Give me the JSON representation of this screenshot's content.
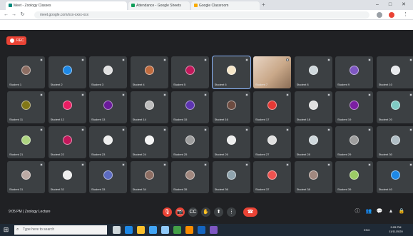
{
  "browser": {
    "tabs": [
      {
        "title": "Meet - Zoology Classes"
      },
      {
        "title": "Attendance - Google Sheets"
      },
      {
        "title": "Google Classroom"
      }
    ],
    "address": "meet.google.com/xxx-xxxx-xxx",
    "new_tab_icon": "plus-icon",
    "window_controls": [
      "minimize-icon",
      "maximize-icon",
      "close-icon"
    ]
  },
  "meet": {
    "recording_label": "REC",
    "meeting_time": "9:05 PM",
    "meeting_title": "Zoology Lecture",
    "controls": [
      {
        "name": "mic-off-button",
        "glyph": "🎙",
        "style": "red"
      },
      {
        "name": "camera-off-button",
        "glyph": "📷",
        "style": "red"
      },
      {
        "name": "captions-button",
        "glyph": "CC",
        "style": "dark"
      },
      {
        "name": "raise-hand-button",
        "glyph": "✋",
        "style": "dark"
      },
      {
        "name": "present-button",
        "glyph": "⬆",
        "style": "dark"
      },
      {
        "name": "more-options-button",
        "glyph": "⋮",
        "style": "dark"
      },
      {
        "name": "leave-call-button",
        "glyph": "☎",
        "style": "leave"
      }
    ],
    "right_controls": [
      {
        "name": "info-button",
        "glyph": "ⓘ"
      },
      {
        "name": "people-button",
        "glyph": "👥"
      },
      {
        "name": "chat-button",
        "glyph": "💬"
      },
      {
        "name": "activities-button",
        "glyph": "▲"
      },
      {
        "name": "lock-button",
        "glyph": "🔒"
      }
    ],
    "participants": [
      {
        "name": "Student 1",
        "color": "#8d6e63"
      },
      {
        "name": "Student 2",
        "color": "#1e88e5"
      },
      {
        "name": "Student 3",
        "color": "#e0e0e0"
      },
      {
        "name": "Student 4",
        "color": "#bf6b3f"
      },
      {
        "name": "Student 5",
        "color": "#c2185b"
      },
      {
        "name": "Student 6",
        "color": "#f5e6c8"
      },
      {
        "name": "Student 7",
        "color": "#d7b89b"
      },
      {
        "name": "Student 8",
        "color": "#cfd8dc"
      },
      {
        "name": "Student 9",
        "color": "#7e57c2"
      },
      {
        "name": "Student 10",
        "color": "#e8eaed"
      },
      {
        "name": "Student 11",
        "color": "#827717"
      },
      {
        "name": "Student 12",
        "color": "#e91e63"
      },
      {
        "name": "Student 13",
        "color": "#6a1b9a"
      },
      {
        "name": "Student 14",
        "color": "#bdbdbd"
      },
      {
        "name": "Student 15",
        "color": "#5e35b1"
      },
      {
        "name": "Student 16",
        "color": "#6d4c41"
      },
      {
        "name": "Student 17",
        "color": "#e53935"
      },
      {
        "name": "Student 18",
        "color": "#e0e0e0"
      },
      {
        "name": "Student 19",
        "color": "#7b1fa2"
      },
      {
        "name": "Student 20",
        "color": "#80cbc4"
      },
      {
        "name": "Student 21",
        "color": "#aed581"
      },
      {
        "name": "Student 22",
        "color": "#c2185b"
      },
      {
        "name": "Student 23",
        "color": "#eeeeee"
      },
      {
        "name": "Student 24",
        "color": "#f5f5f5"
      },
      {
        "name": "Student 25",
        "color": "#9e9e9e"
      },
      {
        "name": "Student 26",
        "color": "#eeeeee"
      },
      {
        "name": "Student 27",
        "color": "#e0e0e0"
      },
      {
        "name": "Student 28",
        "color": "#cfd8dc"
      },
      {
        "name": "Student 29",
        "color": "#9e9e9e"
      },
      {
        "name": "Student 30",
        "color": "#b0bec5"
      },
      {
        "name": "Student 31",
        "color": "#bcaaa4"
      },
      {
        "name": "Student 32",
        "color": "#eeeeee"
      },
      {
        "name": "Student 33",
        "color": "#5c6bc0"
      },
      {
        "name": "Student 34",
        "color": "#8d6e63"
      },
      {
        "name": "Student 35",
        "color": "#a1887f"
      },
      {
        "name": "Student 36",
        "color": "#90a4ae"
      },
      {
        "name": "Student 37",
        "color": "#ef5350"
      },
      {
        "name": "Student 38",
        "color": "#a1887f"
      },
      {
        "name": "Student 39",
        "color": "#9ccc65"
      },
      {
        "name": "Student 40",
        "color": "#1e88e5"
      }
    ]
  },
  "taskbar": {
    "search_placeholder": "Type here to search",
    "apps": [
      {
        "name": "task-view-icon",
        "color": "#cfd8dc"
      },
      {
        "name": "edge-icon",
        "color": "#1e88e5"
      },
      {
        "name": "file-explorer-icon",
        "color": "#fbc02d"
      },
      {
        "name": "store-icon",
        "color": "#42a5f5"
      },
      {
        "name": "mail-icon",
        "color": "#90caf9"
      },
      {
        "name": "chrome-icon",
        "color": "#43a047"
      },
      {
        "name": "vlc-icon",
        "color": "#fb8c00"
      },
      {
        "name": "word-icon",
        "color": "#1565c0"
      },
      {
        "name": "photos-icon",
        "color": "#7e57c2"
      }
    ],
    "tray_text": "ENG",
    "time": "9:05 PM",
    "date": "11/11/2020"
  }
}
